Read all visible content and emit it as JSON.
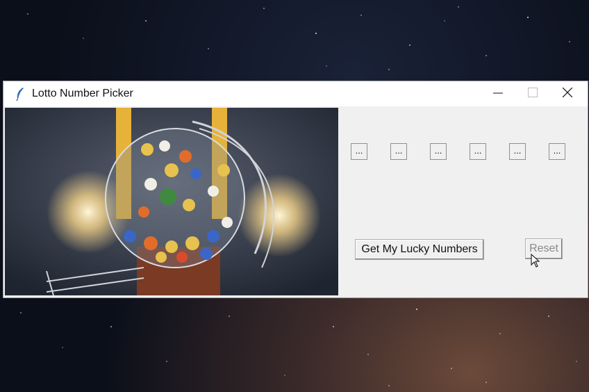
{
  "window": {
    "title": "Lotto Number Picker",
    "icon": "feather-icon"
  },
  "controls": {
    "minimize": "minimize-icon",
    "maximize": "maximize-icon",
    "close": "close-icon"
  },
  "slots": [
    "...",
    "...",
    "...",
    "...",
    "...",
    "..."
  ],
  "buttons": {
    "lucky_label": "Get My Lucky Numbers",
    "reset_label": "Reset"
  },
  "colors": {
    "window_bg": "#f0f0f0",
    "titlebar_bg": "#ffffff",
    "disabled_text": "#8a8a8a"
  }
}
